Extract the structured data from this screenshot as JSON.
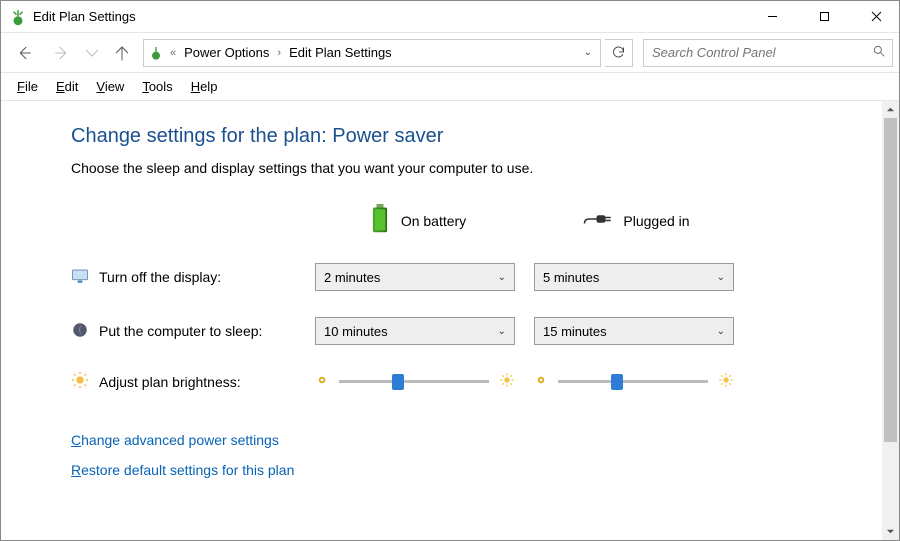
{
  "window": {
    "title": "Edit Plan Settings"
  },
  "breadcrumb": {
    "prefix": "«",
    "items": [
      "Power Options",
      "Edit Plan Settings"
    ]
  },
  "search": {
    "placeholder": "Search Control Panel"
  },
  "menu": {
    "file": "File",
    "edit": "Edit",
    "view": "View",
    "tools": "Tools",
    "help": "Help"
  },
  "page": {
    "heading": "Change settings for the plan: Power saver",
    "subtext": "Choose the sleep and display settings that you want your computer to use.",
    "col_battery": "On battery",
    "col_plugged": "Plugged in",
    "row_display": "Turn off the display:",
    "row_sleep": "Put the computer to sleep:",
    "row_brightness": "Adjust plan brightness:",
    "display_battery": "2 minutes",
    "display_plugged": "5 minutes",
    "sleep_battery": "10 minutes",
    "sleep_plugged": "15 minutes",
    "brightness_battery_pct": 35,
    "brightness_plugged_pct": 35
  },
  "links": {
    "advanced": "Change advanced power settings",
    "restore": "Restore default settings for this plan"
  }
}
